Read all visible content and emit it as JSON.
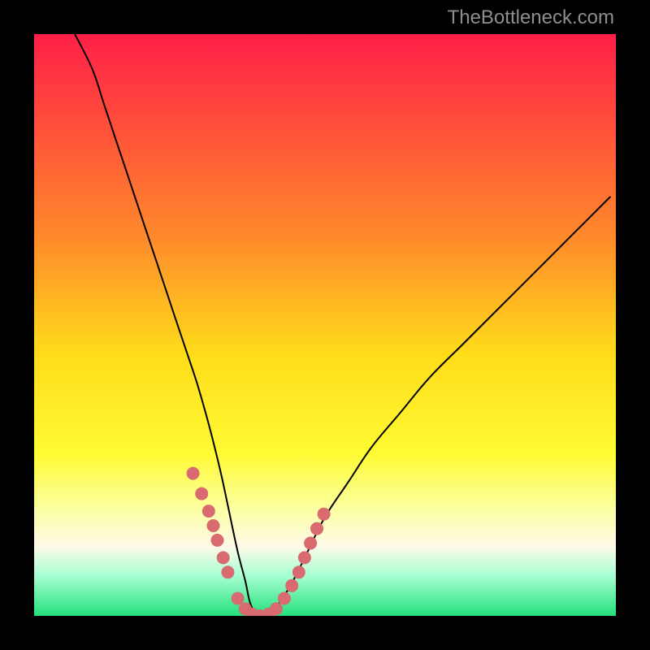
{
  "watermark": "TheBottleneck.com",
  "colors": {
    "frame": "#000000",
    "gradient_stops": [
      {
        "pct": 0,
        "color": "#ff1f47"
      },
      {
        "pct": 35,
        "color": "#ff8a2b"
      },
      {
        "pct": 55,
        "color": "#ffdc1a"
      },
      {
        "pct": 72,
        "color": "#fffb33"
      },
      {
        "pct": 82,
        "color": "#fbffa6"
      },
      {
        "pct": 88,
        "color": "#fff9e8"
      },
      {
        "pct": 93,
        "color": "#a8ffd3"
      },
      {
        "pct": 100,
        "color": "#23e07c"
      }
    ],
    "curve": "#000000",
    "markers": "#d96a6f"
  },
  "chart_data": {
    "type": "line",
    "title": "",
    "xlabel": "",
    "ylabel": "",
    "xlim": [
      0,
      100
    ],
    "ylim": [
      0,
      100
    ],
    "grid": false,
    "legend": false,
    "series": [
      {
        "name": "bottleneck-curve",
        "x": [
          7,
          10,
          12,
          14,
          16,
          18,
          20,
          22,
          24,
          26,
          28,
          30,
          32,
          33.5,
          35,
          36.3,
          37.2,
          38.5,
          40,
          42,
          44.5,
          47,
          50,
          54,
          58,
          63,
          68,
          74,
          80,
          86,
          92,
          99
        ],
        "y": [
          100,
          94,
          88,
          82,
          76,
          70,
          64,
          58,
          52,
          46,
          40,
          33,
          25,
          18,
          11,
          6,
          2,
          0,
          0,
          2,
          6,
          11,
          17,
          23,
          29,
          35,
          41,
          47,
          53,
          59,
          65,
          72
        ]
      }
    ],
    "markers": {
      "name": "highlight-dots",
      "x": [
        27.3,
        28.8,
        30.0,
        30.8,
        31.5,
        32.5,
        33.3,
        35.0,
        36.3,
        37.5,
        38.8,
        40.3,
        41.6,
        43.0,
        44.3,
        45.5,
        46.5,
        47.5,
        48.6,
        49.8
      ],
      "y": [
        24.5,
        21.0,
        18.0,
        15.5,
        13.0,
        10.0,
        7.5,
        3.0,
        1.2,
        0.3,
        0.0,
        0.3,
        1.2,
        3.0,
        5.2,
        7.5,
        10.0,
        12.5,
        15.0,
        17.5
      ]
    }
  }
}
